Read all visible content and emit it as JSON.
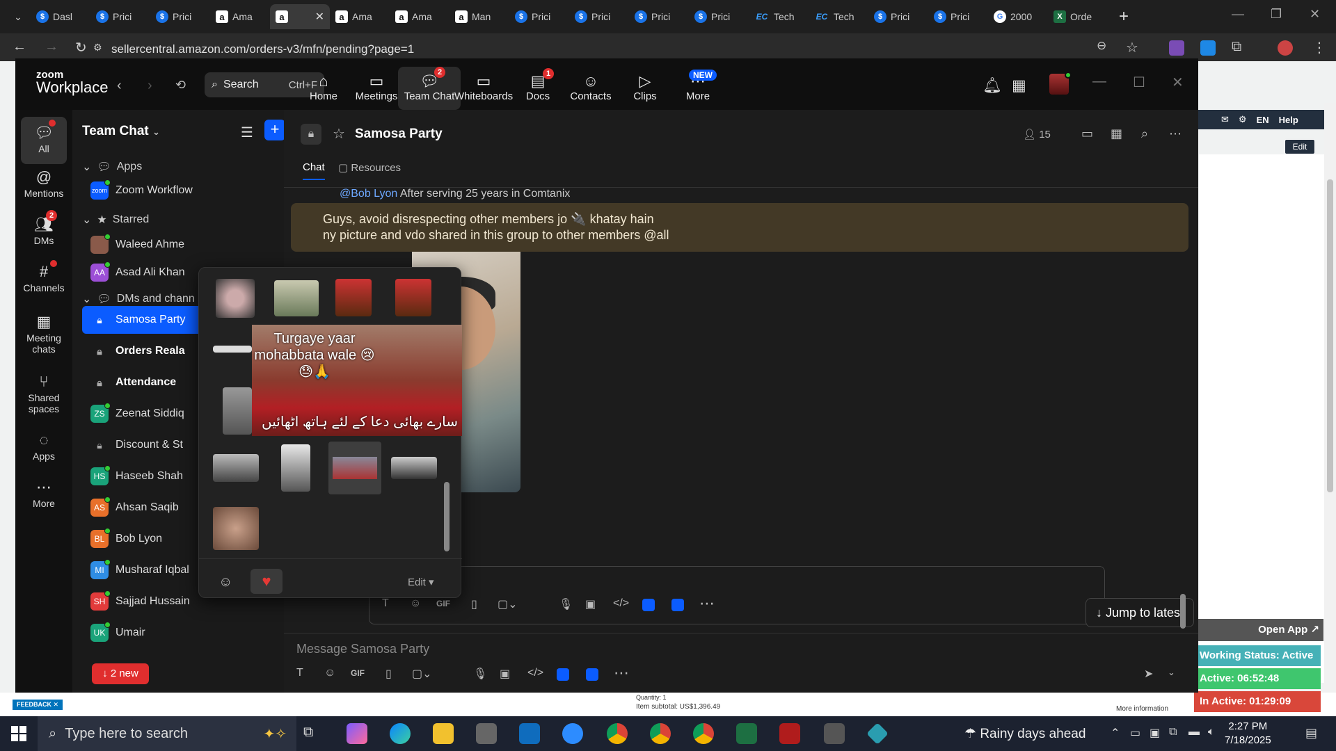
{
  "browser": {
    "tabs": [
      {
        "label": "Dasl",
        "icon": "dollar"
      },
      {
        "label": "Prici",
        "icon": "dollar"
      },
      {
        "label": "Prici",
        "icon": "dollar"
      },
      {
        "label": "Ama",
        "icon": "amazon"
      },
      {
        "label": "",
        "icon": "amazon",
        "active": true
      },
      {
        "label": "Ama",
        "icon": "amazon"
      },
      {
        "label": "Ama",
        "icon": "amazon"
      },
      {
        "label": "Man",
        "icon": "amazon"
      },
      {
        "label": "Prici",
        "icon": "dollar"
      },
      {
        "label": "Prici",
        "icon": "dollar"
      },
      {
        "label": "Prici",
        "icon": "dollar"
      },
      {
        "label": "Prici",
        "icon": "dollar"
      },
      {
        "label": "Tech",
        "icon": "ec"
      },
      {
        "label": "Tech",
        "icon": "ec"
      },
      {
        "label": "Prici",
        "icon": "dollar"
      },
      {
        "label": "Prici",
        "icon": "dollar"
      },
      {
        "label": "2000",
        "icon": "google"
      },
      {
        "label": "Orde",
        "icon": "excel"
      }
    ],
    "url": "sellercentral.amazon.com/orders-v3/mfn/pending?page=1"
  },
  "seller_page": {
    "topbar": [
      "EN",
      "Help"
    ],
    "edit_label": "Edit",
    "feedback_label": "FEEDBACK",
    "quantity": "Quantity: 1",
    "subtotal": "Item subtotal: US$1,396.49",
    "more_info": "More information"
  },
  "tracker": {
    "open_app": "Open App",
    "working_status": "Working Status: Active",
    "active": "Active: 06:52:48",
    "inactive": "In Active: 01:29:09"
  },
  "zoom": {
    "logo_line1": "zoom",
    "logo_line2": "Workplace",
    "search_label": "Search",
    "search_shortcut": "Ctrl+F",
    "nav": [
      {
        "label": "Home",
        "icon": "home-icon"
      },
      {
        "label": "Meetings",
        "icon": "video-icon"
      },
      {
        "label": "Team Chat",
        "icon": "chat-icon",
        "badge": "2",
        "active": true
      },
      {
        "label": "Whiteboards",
        "icon": "whiteboard-icon"
      },
      {
        "label": "Docs",
        "icon": "docs-icon",
        "badge": "1"
      },
      {
        "label": "Contacts",
        "icon": "contacts-icon"
      },
      {
        "label": "Clips",
        "icon": "clips-icon"
      },
      {
        "label": "More",
        "icon": "more-icon",
        "badge_new": "NEW"
      }
    ],
    "rail": [
      {
        "label": "All",
        "icon": "chat-icon"
      },
      {
        "label": "Mentions",
        "icon": "at-icon"
      },
      {
        "label": "DMs",
        "icon": "people-icon",
        "badge": "2"
      },
      {
        "label": "Channels",
        "icon": "hash-icon"
      },
      {
        "label": "Meeting chats",
        "icon": "calendar-icon"
      },
      {
        "label": "Shared spaces",
        "icon": "share-icon"
      },
      {
        "label": "Apps",
        "icon": "apps-icon"
      },
      {
        "label": "More",
        "icon": "more-icon"
      }
    ],
    "sidebar": {
      "title": "Team Chat",
      "sections": {
        "apps": "Apps",
        "starred": "Starred",
        "dms": "DMs and chann"
      },
      "apps_items": [
        {
          "label": "Zoom Workflow"
        }
      ],
      "starred_items": [
        {
          "label": "Waleed Ahme",
          "initials": ""
        },
        {
          "label": "Asad Ali Khan",
          "initials": "AA"
        }
      ],
      "items": [
        {
          "label": "Samosa Party",
          "type": "lock",
          "active": true
        },
        {
          "label": "Orders Reala",
          "type": "lock",
          "bold": true
        },
        {
          "label": "Attendance",
          "type": "lock",
          "bold": true
        },
        {
          "label": "Zeenat Siddiq",
          "initials": "ZS",
          "color": "#1aa37a"
        },
        {
          "label": "Discount & St",
          "type": "lock"
        },
        {
          "label": "Haseeb Shah",
          "initials": "HS",
          "color": "#1aa37a"
        },
        {
          "label": "Ahsan Saqib",
          "initials": "AS",
          "color": "#e8702a"
        },
        {
          "label": "Bob Lyon",
          "initials": "BL",
          "color": "#e8702a"
        },
        {
          "label": "Musharaf Iqbal",
          "initials": "MI",
          "color": "#2f8de4"
        },
        {
          "label": "Sajjad Hussain",
          "initials": "SH",
          "color": "#e23b3b"
        },
        {
          "label": "Umair",
          "initials": "UK",
          "color": "#1aa37a"
        }
      ],
      "new_pill": "2 new"
    },
    "chat": {
      "name": "Samosa Party",
      "members": "15",
      "tab_chat": "Chat",
      "tab_resources": "Resources",
      "cut_mention": "@Bob Lyon",
      "cut_text": "After serving 25 years in Comtanix",
      "pinned_line1": "Guys, avoid disrespecting other members jo 🔌 khatay hain",
      "pinned_line2": "ny picture and vdo shared in this group to other members @all",
      "jump_label": "Jump to latest",
      "message_placeholder": "Message Samosa Party"
    },
    "picker": {
      "preview_caption": "Turgaye yaar mohabbata wale 😢😓🙏",
      "preview_urdu": "سارے بھائی دعا کے لئے ہاتھ اٹھائیں",
      "edit_label": "Edit"
    }
  },
  "taskbar": {
    "search_placeholder": "Type here to search",
    "weather": "Rainy days ahead",
    "time": "2:27 PM",
    "date": "7/18/2025"
  }
}
